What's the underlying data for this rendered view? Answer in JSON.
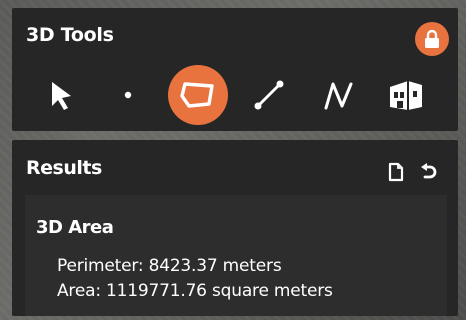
{
  "tools_panel": {
    "title": "3D Tools",
    "lock_icon": "lock-icon",
    "tools": [
      {
        "name": "select",
        "icon": "arrow-pointer-icon",
        "active": false
      },
      {
        "name": "point",
        "icon": "point-icon",
        "active": false
      },
      {
        "name": "area",
        "icon": "polygon-icon",
        "active": true
      },
      {
        "name": "distance",
        "icon": "line-icon",
        "active": false
      },
      {
        "name": "path",
        "icon": "polyline-icon",
        "active": false
      },
      {
        "name": "building",
        "icon": "building-icon",
        "active": false
      }
    ]
  },
  "results_panel": {
    "title": "Results",
    "actions": [
      {
        "name": "export",
        "icon": "document-icon"
      },
      {
        "name": "reset",
        "icon": "undo-icon"
      }
    ],
    "result": {
      "heading": "3D Area",
      "perimeter_text": "Perimeter: 8423.37 meters",
      "area_text": "Area: 1119771.76 square meters"
    }
  },
  "colors": {
    "accent": "#e8733e",
    "panel_bg": "#262626",
    "card_bg": "#2d2d2d",
    "text": "#ffffff"
  }
}
